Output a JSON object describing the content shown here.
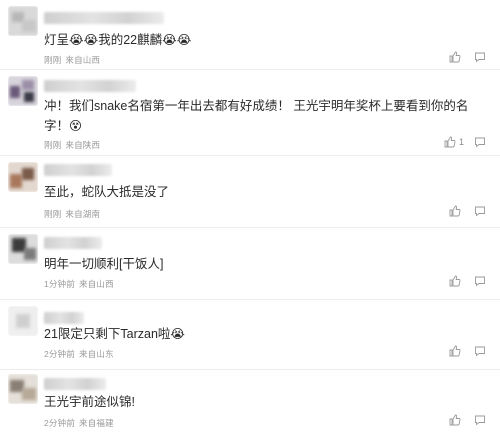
{
  "comments": [
    {
      "text": "灯呈😭😭我的22麒麟😭😭",
      "time": "刚刚",
      "location": "来自山西",
      "likes": ""
    },
    {
      "text": "冲！我们snake名宿第一年出去都有好成绩！ 王光宇明年奖杯上要看到你的名字！😵",
      "time": "刚刚",
      "location": "来自陕西",
      "likes": "1"
    },
    {
      "text": "至此，蛇队大抵是没了",
      "time": "刚刚",
      "location": "来自湖南",
      "likes": ""
    },
    {
      "text": "明年一切顺利[干饭人]",
      "time": "1分钟前",
      "location": "来自山西",
      "likes": ""
    },
    {
      "text": "21限定只剩下Tarzan啦😭",
      "time": "2分钟前",
      "location": "来自山东",
      "likes": ""
    },
    {
      "text": "王光宇前途似锦!",
      "time": "2分钟前",
      "location": "来自福建",
      "likes": ""
    }
  ],
  "icons": {
    "like": "thumbs-up-icon",
    "reply": "comment-icon"
  },
  "colors": {
    "text": "#2a2a2a",
    "meta": "#9a9a9a",
    "divider": "#ececec"
  }
}
